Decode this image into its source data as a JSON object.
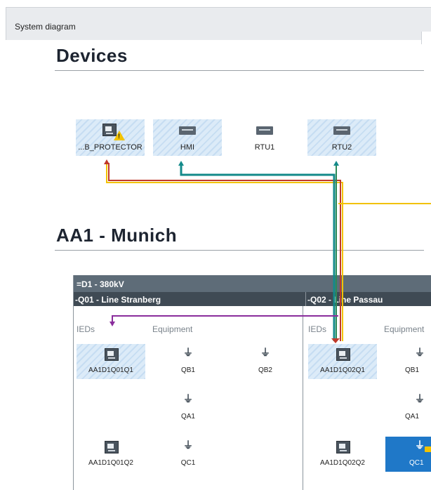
{
  "window": {
    "title": "System diagram"
  },
  "devices_section": {
    "title": "Devices"
  },
  "devices": [
    {
      "label": "...B_PROTECTOR",
      "icon": "ied-icon",
      "status": "warning-icon",
      "highlighted": true
    },
    {
      "label": "HMI",
      "icon": "rack-device-icon",
      "highlighted": true
    },
    {
      "label": "RTU1",
      "icon": "rack-device-icon",
      "highlighted": false
    },
    {
      "label": "RTU2",
      "icon": "rack-device-icon",
      "highlighted": true
    }
  ],
  "site": {
    "title": "AA1 - Munich"
  },
  "voltage_level": {
    "label": "=D1 - 380kV"
  },
  "bays": [
    {
      "label": "-Q01 - Line Stranberg",
      "ieds_header": "IEDs",
      "equipment_header": "Equipment",
      "ieds": [
        {
          "label": "AA1D1Q01Q1",
          "highlighted": true
        },
        {
          "label": "AA1D1Q01Q2",
          "highlighted": false
        }
      ],
      "equipment": [
        {
          "label": "QB1",
          "icon": "disconnector-icon"
        },
        {
          "label": "QB2",
          "icon": "disconnector-icon"
        },
        {
          "label": "QA1",
          "icon": "circuit-breaker-icon"
        },
        {
          "label": "QC1",
          "icon": "earthing-switch-icon"
        }
      ]
    },
    {
      "label": "-Q02 - Line Passau",
      "ieds_header": "IEDs",
      "equipment_header": "Equipment",
      "ieds": [
        {
          "label": "AA1D1Q02Q1",
          "highlighted": true
        },
        {
          "label": "AA1D1Q02Q2",
          "highlighted": false
        }
      ],
      "equipment": [
        {
          "label": "QB1",
          "icon": "disconnector-icon"
        },
        {
          "label": "QA1",
          "icon": "circuit-breaker-icon"
        },
        {
          "label": "QC1",
          "icon": "earthing-switch-icon",
          "selected": true,
          "locked": true
        }
      ]
    }
  ],
  "colors": {
    "yellow_link": "#f2c200",
    "red_link": "#c0392b",
    "teal_link": "#138a8a",
    "purple_link": "#8a2d9c",
    "green_link": "#2e8b57",
    "selection": "#1f78c8",
    "header_dark": "#3f4a54",
    "header_mid": "#5e6c78"
  }
}
